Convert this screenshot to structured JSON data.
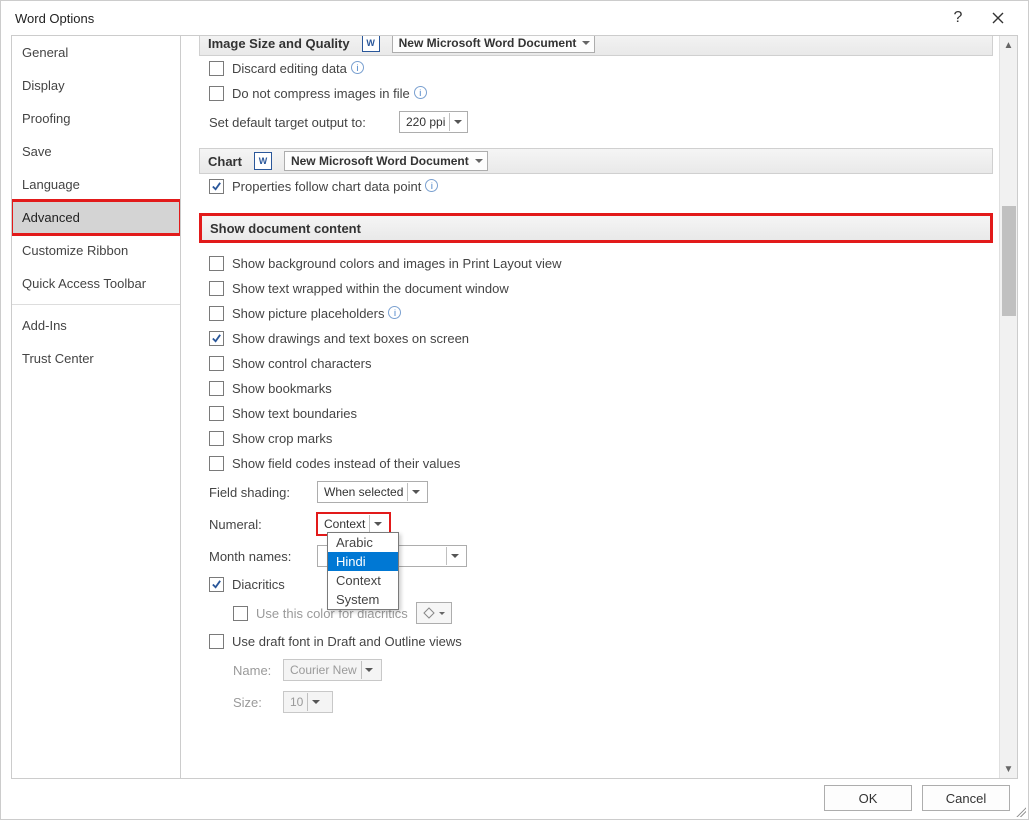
{
  "title": "Word Options",
  "sidebar": {
    "items": [
      {
        "label": "General"
      },
      {
        "label": "Display"
      },
      {
        "label": "Proofing"
      },
      {
        "label": "Save"
      },
      {
        "label": "Language"
      },
      {
        "label": "Advanced",
        "selected": true
      },
      {
        "label": "Customize Ribbon"
      },
      {
        "label": "Quick Access Toolbar"
      },
      {
        "label": "Add-Ins"
      },
      {
        "label": "Trust Center"
      }
    ]
  },
  "section_image": {
    "title": "Image Size and Quality",
    "doc": "New Microsoft Word Document",
    "opts": {
      "discard": "Discard editing data",
      "nocompress": "Do not compress images in file",
      "target_label": "Set default target output to:",
      "target_value": "220 ppi"
    }
  },
  "section_chart": {
    "title": "Chart",
    "doc": "New Microsoft Word Document",
    "opts": {
      "propfollow": "Properties follow chart data point"
    }
  },
  "section_showdoc": {
    "title": "Show document content",
    "opts": {
      "bgcolors": "Show background colors and images in Print Layout view",
      "wrapped": "Show text wrapped within the document window",
      "picph": "Show picture placeholders",
      "drawings": "Show drawings and text boxes on screen",
      "ctrlchars": "Show control characters",
      "bookmarks": "Show bookmarks",
      "textbound": "Show text boundaries",
      "cropmarks": "Show crop marks",
      "fieldcodes": "Show field codes instead of their values"
    },
    "field_shading_label": "Field shading:",
    "field_shading_value": "When selected",
    "numeral_label": "Numeral:",
    "numeral_value": "Context",
    "numeral_options": [
      "Arabic",
      "Hindi",
      "Context",
      "System"
    ],
    "month_names_label": "Month names:",
    "month_names_value": "",
    "diacritics": "Diacritics",
    "diacritics_color": "Use this color for diacritics",
    "draftfont": "Use draft font in Draft and Outline views",
    "name_label": "Name:",
    "name_value": "Courier New",
    "size_label": "Size:",
    "size_value": "10"
  },
  "footer": {
    "ok": "OK",
    "cancel": "Cancel"
  }
}
